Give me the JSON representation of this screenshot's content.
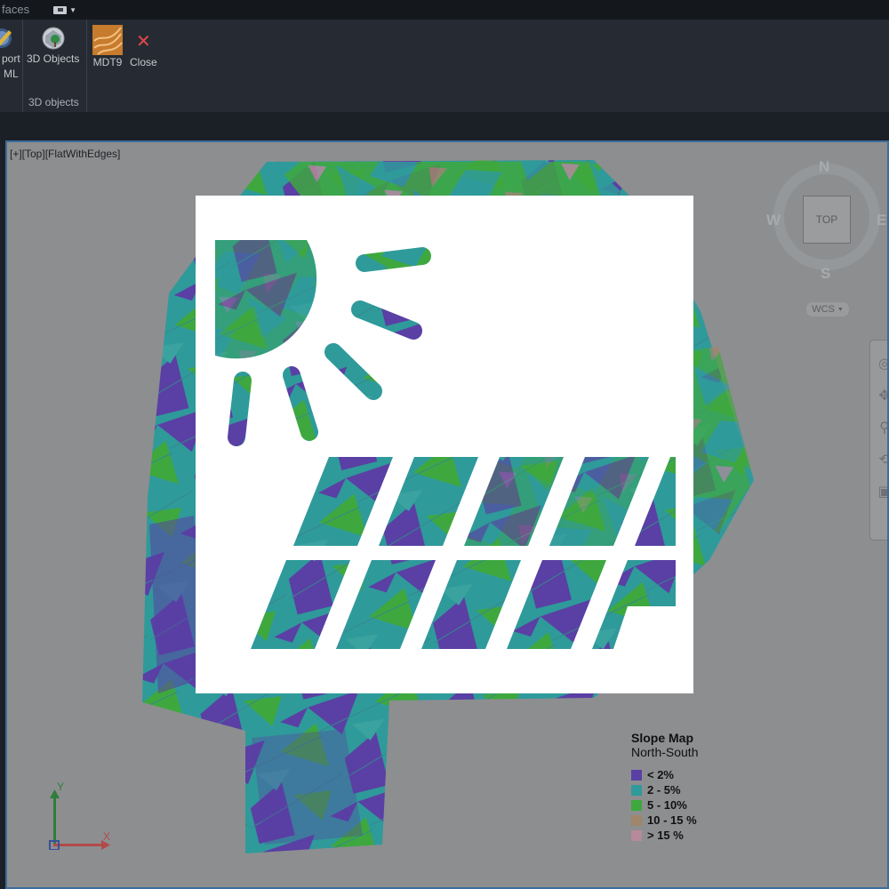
{
  "ribbon": {
    "tab_label": "faces",
    "buttons": {
      "export_kml_line1": "port",
      "export_kml_line2": "ML",
      "objects_3d": "3D Objects",
      "mdt9": "MDT9",
      "close": "Close"
    },
    "group_caption": "3D objects"
  },
  "viewport": {
    "label": "[+][Top][FlatWithEdges]"
  },
  "viewcube": {
    "north": "N",
    "south": "S",
    "east": "E",
    "west": "W",
    "face": "TOP",
    "wcs": "WCS"
  },
  "legend": {
    "title": "Slope Map",
    "subtitle": "North-South",
    "items": [
      {
        "label": "< 2%",
        "color": "#5a3fa4"
      },
      {
        "label": "2 - 5%",
        "color": "#2f9a9a"
      },
      {
        "label": "5 - 10%",
        "color": "#3ea83f"
      },
      {
        "label": "10 - 15 %",
        "color": "#a0866a"
      },
      {
        "label": "> 15 %",
        "color": "#b68a9a"
      }
    ]
  },
  "ucs": {
    "x": "X",
    "y": "Y"
  },
  "colors": {
    "slope_lt2": "#5a3fa4",
    "slope_2_5": "#2f9a9a",
    "slope_5_10": "#3ea83f",
    "slope_10_15": "#a0866a",
    "slope_gt15": "#b68a9a",
    "viewport_bg": "#8d8e90",
    "ribbon_bg": "#262b33"
  },
  "icons": [
    "export-kml-icon",
    "3d-objects-icon",
    "mdt9-icon",
    "close-icon",
    "solar-panel-icon",
    "sun-icon",
    "ucs-icon"
  ]
}
